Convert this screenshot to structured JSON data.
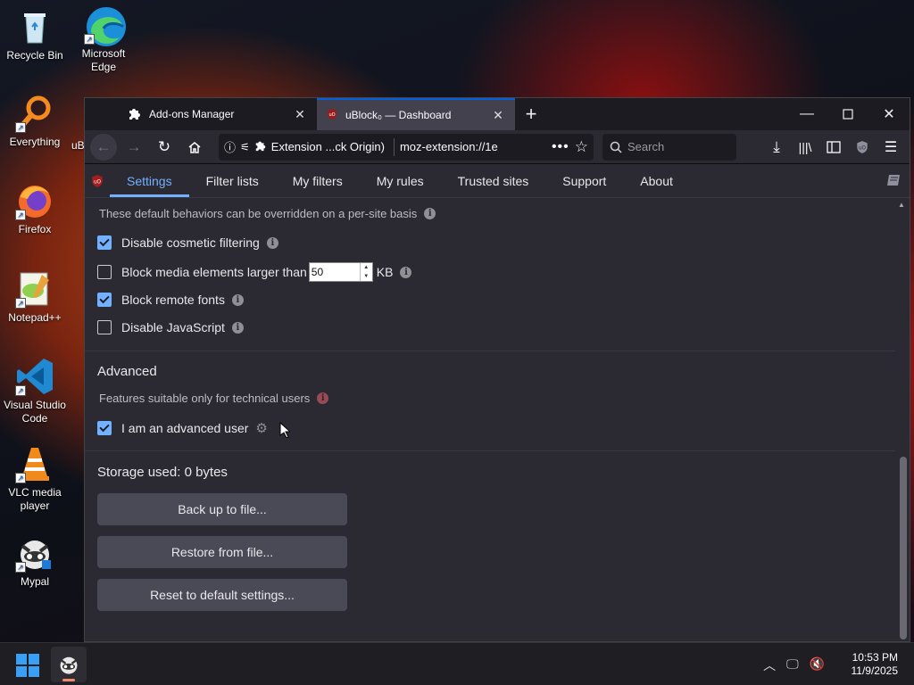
{
  "desktop": {
    "icons": [
      {
        "label": "Recycle Bin",
        "icon": "recycle-bin-icon"
      },
      {
        "label": "Microsoft Edge",
        "icon": "edge-icon"
      },
      {
        "label": "Everything",
        "icon": "everything-search-icon"
      },
      {
        "label": "uB",
        "icon": "ublock-icon"
      },
      {
        "label": "Firefox",
        "icon": "firefox-icon"
      },
      {
        "label": "Notepad++",
        "icon": "notepad-plus-plus-icon"
      },
      {
        "label": "Visual Studio Code",
        "icon": "vscode-icon"
      },
      {
        "label": "VLC media player",
        "icon": "vlc-icon"
      },
      {
        "label": "Mypal",
        "icon": "mypal-icon"
      }
    ]
  },
  "browser": {
    "tabs": [
      {
        "title": "Add-ons Manager",
        "icon": "puzzle-icon"
      },
      {
        "title": "uBlock₀ — Dashboard",
        "icon": "ublock-icon",
        "active": true
      }
    ],
    "urlbar": {
      "identity": "Extension ...ck Origin)",
      "url": "moz-extension://1e"
    },
    "search_placeholder": "Search"
  },
  "dashboard": {
    "tabs": [
      "Settings",
      "Filter lists",
      "My filters",
      "My rules",
      "Trusted sites",
      "Support",
      "About"
    ],
    "active_tab": "Settings",
    "default_behavior_note": "These default behaviors can be overridden on a per-site basis",
    "options": [
      {
        "label": "Disable cosmetic filtering",
        "checked": true
      },
      {
        "label": "Block media elements larger than",
        "checked": false,
        "value": "50",
        "unit": "KB"
      },
      {
        "label": "Block remote fonts",
        "checked": true
      },
      {
        "label": "Disable JavaScript",
        "checked": false
      }
    ],
    "advanced": {
      "title": "Advanced",
      "note": "Features suitable only for technical users",
      "option": {
        "label": "I am an advanced user",
        "checked": true
      }
    },
    "storage_used": "Storage used: 0 bytes",
    "buttons": {
      "backup": "Back up to file...",
      "restore": "Restore from file...",
      "reset": "Reset to default settings..."
    }
  },
  "taskbar": {
    "time": "10:53 PM",
    "date": "11/9/2025"
  },
  "colors": {
    "accent": "#72b1ff",
    "firefox_tab_accent": "#0060df",
    "bg": "#2b2a33"
  }
}
